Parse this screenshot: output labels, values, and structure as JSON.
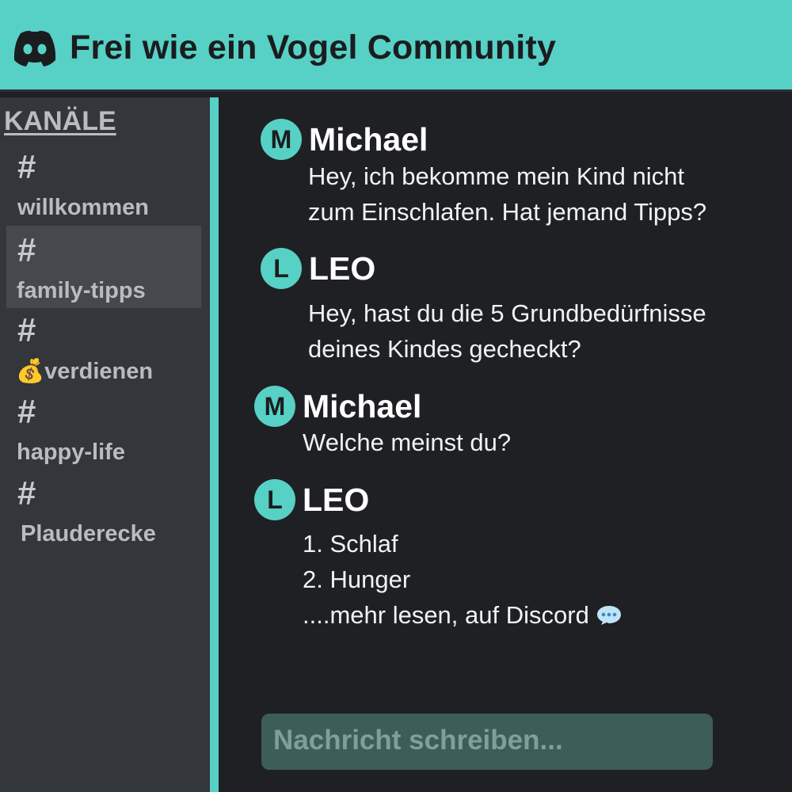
{
  "header": {
    "title": "Frei wie ein Vogel Community",
    "logo_icon": "discord-logo-icon"
  },
  "sidebar": {
    "section_title": "KANÄLE",
    "channels": [
      {
        "hash": "#",
        "label": "willkommen",
        "active": false
      },
      {
        "hash": "#",
        "label": "family-tipps",
        "active": true
      },
      {
        "hash": "#",
        "label": "💰verdienen",
        "active": false
      },
      {
        "hash": "#",
        "label": "happy-life",
        "active": false
      },
      {
        "hash": "#",
        "label": "Plauderecke",
        "active": false
      }
    ]
  },
  "messages": [
    {
      "avatar": "M",
      "author": "Michael",
      "lines": [
        "Hey, ich bekomme mein Kind nicht",
        "zum Einschlafen. Hat jemand Tipps?"
      ]
    },
    {
      "avatar": "L",
      "author": "LEO",
      "lines": [
        "Hey, hast du die 5 Grundbedürfnisse",
        "deines Kindes gecheckt?"
      ]
    },
    {
      "avatar": "M",
      "author": "Michael",
      "lines": [
        "Welche meinst du?"
      ]
    },
    {
      "avatar": "L",
      "author": "LEO",
      "lines": [
        "1. Schlaf",
        "2. Hunger",
        "....mehr lesen, auf Discord"
      ]
    }
  ],
  "composer": {
    "placeholder": "Nachricht schreiben..."
  },
  "colors": {
    "accent": "#57d0c5",
    "sidebar": "#33363b",
    "chat_bg": "#1f2023",
    "active_channel": "#45484d"
  },
  "icons": {
    "speech_bubble": "speech-bubble-icon"
  }
}
